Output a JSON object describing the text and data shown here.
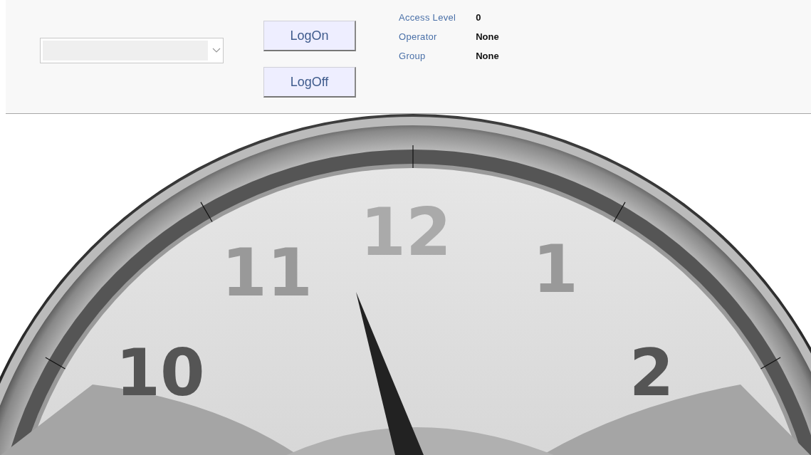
{
  "login_panel": {
    "buttons": [
      "LogOn",
      "LogOff"
    ],
    "info": [
      {
        "label": "Access Level",
        "value": "0"
      },
      {
        "label": "Operator",
        "value": "None"
      },
      {
        "label": "Group",
        "value": "None"
      }
    ]
  },
  "clock": {
    "numerals": [
      "10",
      "11",
      "12",
      "1",
      "2"
    ]
  }
}
